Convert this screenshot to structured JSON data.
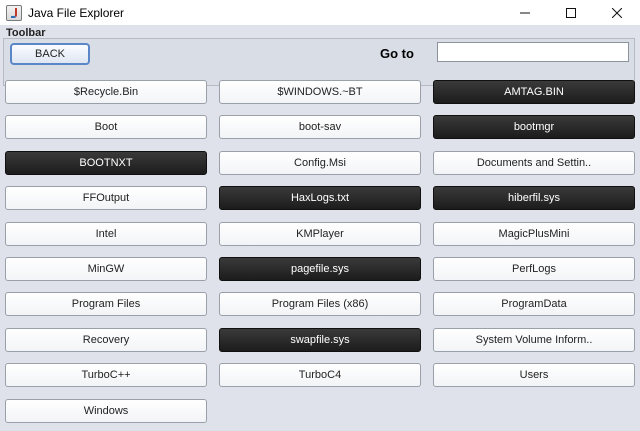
{
  "window": {
    "title": "Java File Explorer",
    "icon": "java-app-icon",
    "minimize_icon": "minimize-icon",
    "maximize_icon": "maximize-icon",
    "close_icon": "close-icon"
  },
  "menubar": {
    "label": "Toolbar"
  },
  "toolbar": {
    "back_label": "BACK",
    "goto_label": "Go to",
    "goto_value": ""
  },
  "colors": {
    "file_button_bg": "#ffffff",
    "hidden_file_button_bg": "#1e1e1e",
    "frame_bg": "#dfe2ea",
    "back_button_border": "#5b87c9"
  },
  "files": [
    {
      "name": "$Recycle.Bin",
      "dark": false
    },
    {
      "name": "$WINDOWS.~BT",
      "dark": false
    },
    {
      "name": "AMTAG.BIN",
      "dark": true
    },
    {
      "name": "Boot",
      "dark": false
    },
    {
      "name": "boot-sav",
      "dark": false
    },
    {
      "name": "bootmgr",
      "dark": true
    },
    {
      "name": "BOOTNXT",
      "dark": true
    },
    {
      "name": "Config.Msi",
      "dark": false
    },
    {
      "name": "Documents and Settin..",
      "dark": false
    },
    {
      "name": "FFOutput",
      "dark": false
    },
    {
      "name": "HaxLogs.txt",
      "dark": true
    },
    {
      "name": "hiberfil.sys",
      "dark": true
    },
    {
      "name": "Intel",
      "dark": false
    },
    {
      "name": "KMPlayer",
      "dark": false
    },
    {
      "name": "MagicPlusMini",
      "dark": false
    },
    {
      "name": "MinGW",
      "dark": false
    },
    {
      "name": "pagefile.sys",
      "dark": true
    },
    {
      "name": "PerfLogs",
      "dark": false
    },
    {
      "name": "Program Files",
      "dark": false
    },
    {
      "name": "Program Files (x86)",
      "dark": false
    },
    {
      "name": "ProgramData",
      "dark": false
    },
    {
      "name": "Recovery",
      "dark": false
    },
    {
      "name": "swapfile.sys",
      "dark": true
    },
    {
      "name": "System Volume Inform..",
      "dark": false
    },
    {
      "name": "TurboC++",
      "dark": false
    },
    {
      "name": "TurboC4",
      "dark": false
    },
    {
      "name": "Users",
      "dark": false
    },
    {
      "name": "Windows",
      "dark": false
    }
  ]
}
